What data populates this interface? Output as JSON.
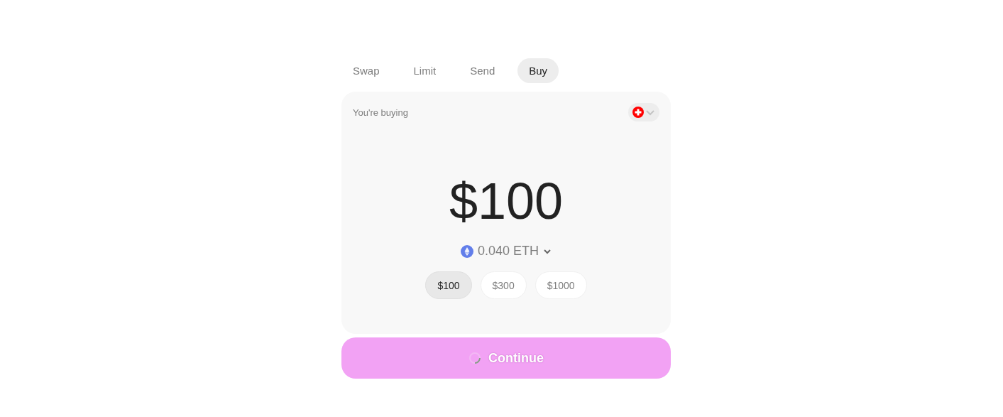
{
  "tabs": [
    {
      "label": "Swap",
      "selected": false
    },
    {
      "label": "Limit",
      "selected": false
    },
    {
      "label": "Send",
      "selected": false
    },
    {
      "label": "Buy",
      "selected": true
    }
  ],
  "card": {
    "label": "You're buying",
    "amount": "$100",
    "conversion": "0.040 ETH",
    "presets": [
      {
        "label": "$100",
        "selected": true
      },
      {
        "label": "$300",
        "selected": false
      },
      {
        "label": "$1000",
        "selected": false
      }
    ]
  },
  "continue_button": {
    "label": "Continue",
    "loading": true
  }
}
